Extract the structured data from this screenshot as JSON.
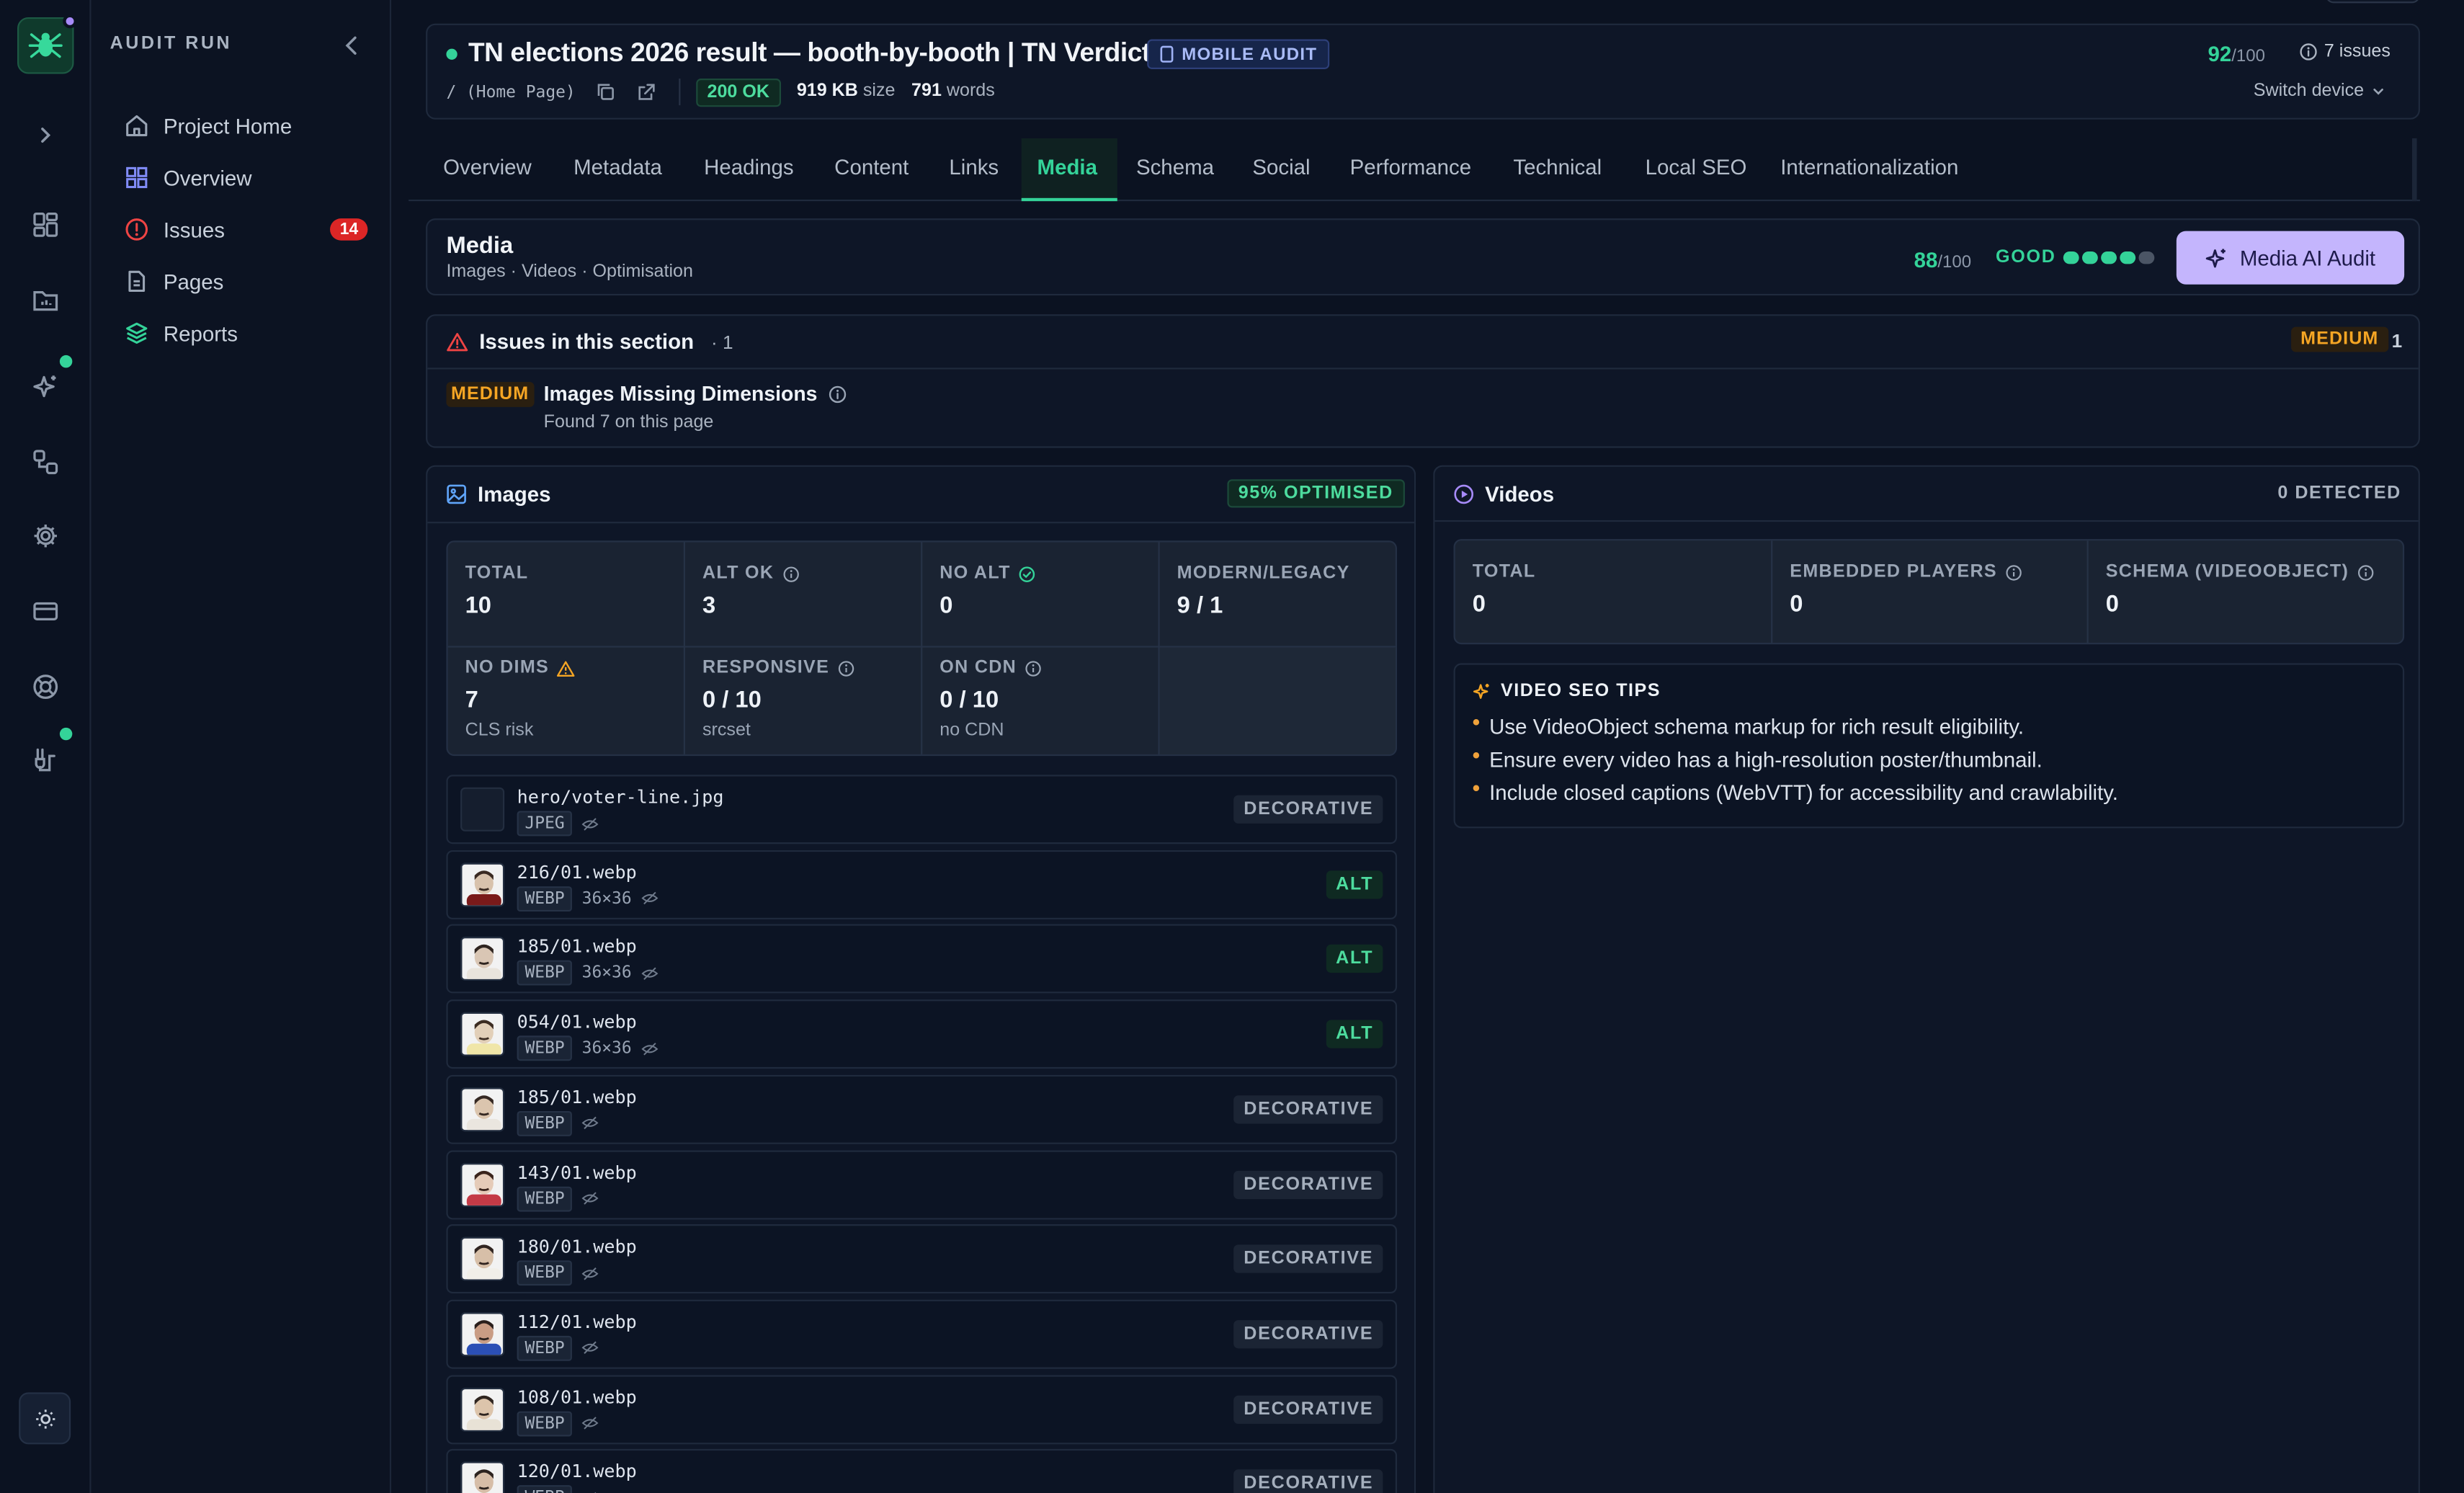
{
  "sidebar": {
    "title": "AUDIT RUN",
    "items": [
      {
        "label": "Project Home",
        "icon": "home-icon"
      },
      {
        "label": "Overview",
        "icon": "grid-icon"
      },
      {
        "label": "Issues",
        "icon": "alert-circle-icon",
        "badge": "14"
      },
      {
        "label": "Pages",
        "icon": "file-icon"
      },
      {
        "label": "Reports",
        "icon": "layers-icon"
      }
    ]
  },
  "header": {
    "title": "TN elections 2026 result — booth-by-booth | TN Verdict",
    "audit_badge": "MOBILE AUDIT",
    "path": "/ (Home Page)",
    "status": "200 OK",
    "size_value": "919 KB",
    "size_label": "size",
    "words_value": "791",
    "words_label": "words",
    "score": "92",
    "score_max": "/100",
    "issues": "7 issues",
    "switch_device": "Switch device"
  },
  "tabs": [
    "Overview",
    "Metadata",
    "Headings",
    "Content",
    "Links",
    "Media",
    "Schema",
    "Social",
    "Performance",
    "Technical",
    "Local SEO",
    "Internationalization"
  ],
  "active_tab": "Media",
  "section": {
    "title": "Media",
    "subtitle": "Images · Videos · Optimisation",
    "score": "88",
    "score_max": "/100",
    "grade": "GOOD",
    "ai_button": "Media AI Audit"
  },
  "issues_section": {
    "title": "Issues in this section",
    "count": "· 1",
    "severity_badge": "MEDIUM",
    "severity_count": "1",
    "item": {
      "severity": "MEDIUM",
      "title": "Images Missing Dimensions",
      "detail": "Found 7 on this page"
    }
  },
  "images": {
    "title": "Images",
    "badge": "95% OPTIMISED",
    "stats": [
      {
        "label": "TOTAL",
        "value": "10",
        "sub": ""
      },
      {
        "label": "ALT OK",
        "value": "3",
        "sub": ""
      },
      {
        "label": "NO ALT",
        "value": "0",
        "sub": ""
      },
      {
        "label": "MODERN/LEGACY",
        "value": "9 / 1",
        "sub": ""
      },
      {
        "label": "NO DIMS",
        "value": "7",
        "sub": "CLS risk"
      },
      {
        "label": "RESPONSIVE",
        "value": "0 / 10",
        "sub": "srcset"
      },
      {
        "label": "ON CDN",
        "value": "0 / 10",
        "sub": "no CDN"
      }
    ],
    "rows": [
      {
        "name": "hero/voter-line.jpg",
        "format": "JPEG",
        "dims": "",
        "tag": "DECORATIVE"
      },
      {
        "name": "216/01.webp",
        "format": "WEBP",
        "dims": "36×36",
        "tag": "ALT"
      },
      {
        "name": "185/01.webp",
        "format": "WEBP",
        "dims": "36×36",
        "tag": "ALT"
      },
      {
        "name": "054/01.webp",
        "format": "WEBP",
        "dims": "36×36",
        "tag": "ALT"
      },
      {
        "name": "185/01.webp",
        "format": "WEBP",
        "dims": "",
        "tag": "DECORATIVE"
      },
      {
        "name": "143/01.webp",
        "format": "WEBP",
        "dims": "",
        "tag": "DECORATIVE"
      },
      {
        "name": "180/01.webp",
        "format": "WEBP",
        "dims": "",
        "tag": "DECORATIVE"
      },
      {
        "name": "112/01.webp",
        "format": "WEBP",
        "dims": "",
        "tag": "DECORATIVE"
      },
      {
        "name": "108/01.webp",
        "format": "WEBP",
        "dims": "",
        "tag": "DECORATIVE"
      },
      {
        "name": "120/01.webp",
        "format": "WEBP",
        "dims": "",
        "tag": "DECORATIVE"
      }
    ]
  },
  "videos": {
    "title": "Videos",
    "badge": "0 DETECTED",
    "stats": [
      {
        "label": "TOTAL",
        "value": "0"
      },
      {
        "label": "EMBEDDED PLAYERS",
        "value": "0"
      },
      {
        "label": "SCHEMA (VIDEOOBJECT)",
        "value": "0"
      }
    ],
    "tips_title": "VIDEO SEO TIPS",
    "tips": [
      "Use VideoObject schema markup for rich result eligibility.",
      "Ensure every video has a high-resolution poster/thumbnail.",
      "Include closed captions (WebVTT) for accessibility and crawlability."
    ]
  },
  "colors": {
    "accent_green": "#34d399",
    "accent_purple": "#c4b5fd",
    "danger": "#ef4444",
    "warning": "#f5a524"
  }
}
